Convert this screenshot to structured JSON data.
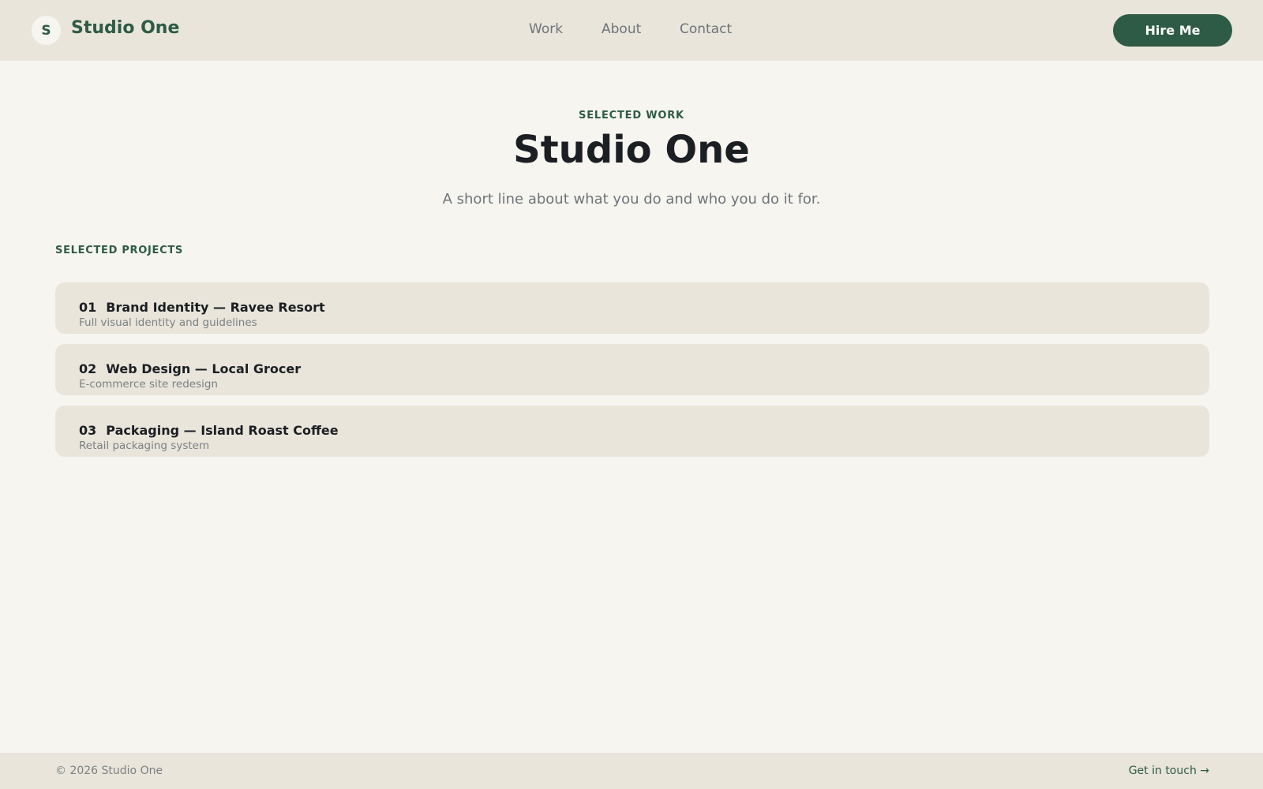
{
  "header": {
    "logo_letter": "S",
    "brand_name": "Studio One",
    "nav": [
      "Work",
      "About",
      "Contact"
    ],
    "cta_label": "Hire Me"
  },
  "hero": {
    "eyebrow": "SELECTED WORK",
    "title": "Studio One",
    "subtitle": "A short line about what you do and who you do it for."
  },
  "projects": {
    "section_label": "SELECTED PROJECTS",
    "items": [
      {
        "number": "01",
        "title": "Brand Identity — Ravee Resort",
        "description": "Full visual identity and guidelines"
      },
      {
        "number": "02",
        "title": "Web Design — Local Grocer",
        "description": "E-commerce site redesign"
      },
      {
        "number": "03",
        "title": "Packaging — Island Roast Coffee",
        "description": "Retail packaging system"
      }
    ]
  },
  "footer": {
    "copyright": "© 2026 Studio One",
    "cta": "Get in touch →"
  },
  "colors": {
    "accent": "#2e5b45",
    "background": "#f6f5f0",
    "surface": "#e9e5da",
    "text": "#1b1f24",
    "muted": "#6d747a"
  }
}
